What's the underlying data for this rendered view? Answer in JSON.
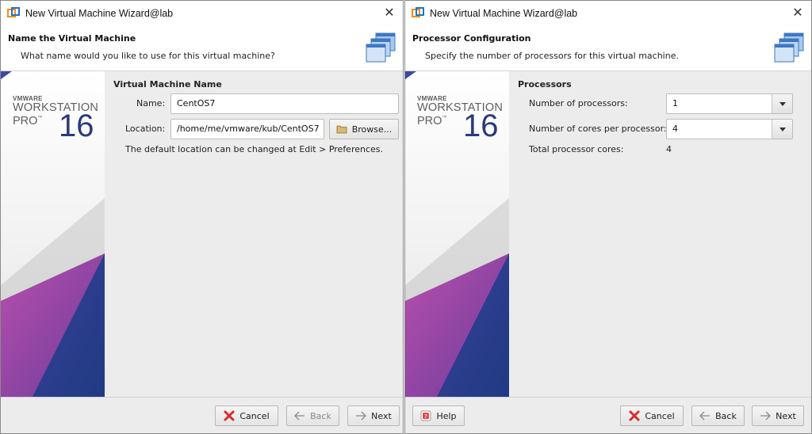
{
  "colors": {
    "brand_blue": "#2b3a7e",
    "cancel_red": "#d92b2b",
    "dialog_bg": "#ececec"
  },
  "left": {
    "title": "New Virtual Machine Wizard@lab",
    "header_title": "Name the Virtual Machine",
    "header_subtitle": "What name would you like to use for this virtual machine?",
    "logo": {
      "brand": "VMWARE",
      "product": "WORKSTATION",
      "edition": "PRO",
      "tm": "™",
      "version": "16"
    },
    "section_title": "Virtual Machine Name",
    "name_label": "Name:",
    "name_value": "CentOS7",
    "location_label": "Location:",
    "location_value": "/home/me/vmware/kub/CentOS7",
    "browse_label": "Browse...",
    "hint": "The default location can be changed at Edit > Preferences.",
    "buttons": {
      "cancel": "Cancel",
      "back": "Back",
      "next": "Next"
    }
  },
  "right": {
    "title": "New Virtual Machine Wizard@lab",
    "header_title": "Processor Configuration",
    "header_subtitle": "Specify the number of processors for this virtual machine.",
    "logo": {
      "brand": "VMWARE",
      "product": "WORKSTATION",
      "edition": "PRO",
      "tm": "™",
      "version": "16"
    },
    "section_title": "Processors",
    "num_processors_label": "Number of processors:",
    "num_processors_value": "1",
    "cores_label": "Number of cores per processor:",
    "cores_value": "4",
    "total_label": "Total processor cores:",
    "total_value": "4",
    "buttons": {
      "help": "Help",
      "cancel": "Cancel",
      "back": "Back",
      "next": "Next"
    }
  }
}
